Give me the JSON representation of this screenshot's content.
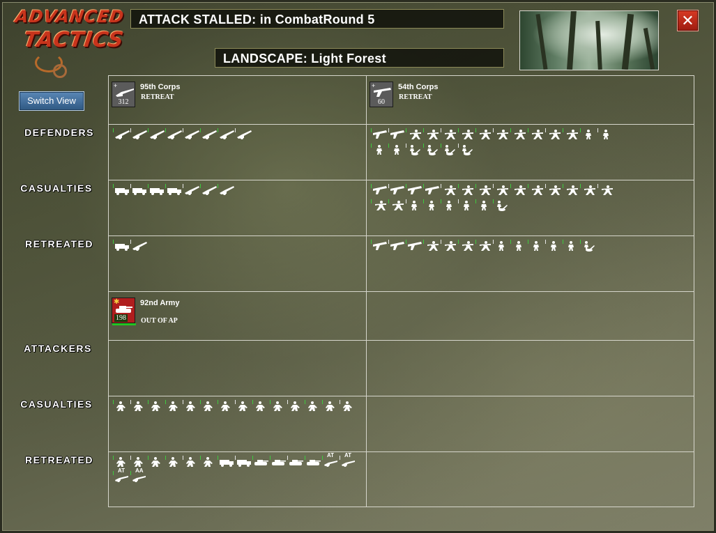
{
  "logo": {
    "line1": "ADVANCED",
    "line2": "TACTICS"
  },
  "header": {
    "result_text": "ATTACK STALLED: in CombatRound  5",
    "landscape_text": "LANDSCAPE: Light Forest",
    "close_label": "✕"
  },
  "controls": {
    "switch_view_label": "Switch View"
  },
  "row_labels": {
    "defenders": "DEFENDERS",
    "def_casualties": "CASUALTIES",
    "def_retreated": "RETREATED",
    "attackers": "ATTACKERS",
    "att_casualties": "CASUALTIES",
    "att_retreated": "RETREATED"
  },
  "defender_units": [
    {
      "name": "95th Corps",
      "status": "RETREAT",
      "strength": "312",
      "icon": "artillery-icon",
      "defenders": [
        "artillery",
        "artillery",
        "artillery",
        "artillery",
        "artillery",
        "artillery",
        "artillery",
        "artillery"
      ],
      "casualties": [
        "truck",
        "truck",
        "truck",
        "truck",
        "artillery",
        "artillery",
        "artillery"
      ],
      "retreated": [
        "truck",
        "artillery"
      ]
    },
    {
      "name": "54th Corps",
      "status": "RETREAT",
      "strength": "60",
      "icon": "machinegun-icon",
      "defenders": [
        "mg",
        "mg",
        "rifleman",
        "rifleman",
        "rifleman",
        "rifleman",
        "rifleman",
        "rifleman",
        "rifleman",
        "rifleman",
        "rifleman",
        "rifleman",
        "infantry",
        "infantry",
        "infantry",
        "infantry",
        "mortar",
        "mortar",
        "mortar",
        "mortar"
      ],
      "casualties": [
        "mg",
        "mg",
        "mg",
        "mg",
        "rifleman",
        "rifleman",
        "rifleman",
        "rifleman",
        "rifleman",
        "rifleman",
        "rifleman",
        "rifleman",
        "rifleman",
        "rifleman",
        "rifleman",
        "rifleman",
        "infantry",
        "infantry",
        "infantry",
        "infantry",
        "infantry",
        "mortar"
      ],
      "retreated": [
        "mg",
        "mg",
        "mg",
        "rifleman",
        "rifleman",
        "rifleman",
        "rifleman",
        "infantry",
        "infantry",
        "infantry",
        "infantry",
        "infantry",
        "mortar"
      ]
    }
  ],
  "attacker_units": [
    {
      "name": "92nd Army",
      "status": "OUT OF AP",
      "strength": "198",
      "icon": "tank-icon",
      "casualties": [
        "soldier",
        "soldier",
        "soldier",
        "soldier",
        "soldier",
        "soldier",
        "soldier",
        "soldier",
        "soldier",
        "soldier",
        "soldier",
        "soldier",
        "soldier",
        "soldier"
      ],
      "retreated": [
        {
          "t": "soldier"
        },
        {
          "t": "soldier"
        },
        {
          "t": "soldier"
        },
        {
          "t": "soldier"
        },
        {
          "t": "soldier"
        },
        {
          "t": "soldier"
        },
        {
          "t": "truck"
        },
        {
          "t": "truck"
        },
        {
          "t": "tank"
        },
        {
          "t": "tank"
        },
        {
          "t": "tank"
        },
        {
          "t": "tank"
        },
        {
          "t": "gun",
          "label": "AT"
        },
        {
          "t": "gun",
          "label": "AT"
        },
        {
          "t": "gun",
          "label": "AT"
        },
        {
          "t": "gun",
          "label": "AA"
        }
      ]
    }
  ]
}
